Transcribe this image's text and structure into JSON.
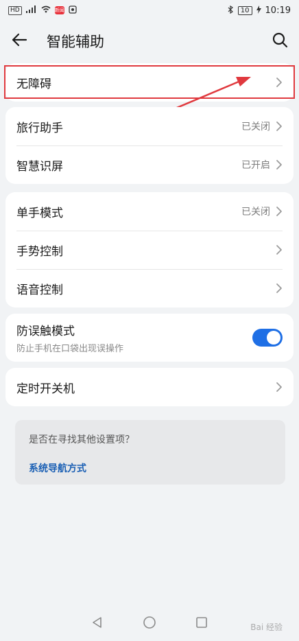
{
  "status_bar": {
    "left_chips": [
      "HD",
      "4G"
    ],
    "red_chip": "新闻",
    "battery": "10",
    "time": "10:19"
  },
  "header": {
    "title": "智能辅助",
    "back_icon": "back-arrow-icon",
    "search_icon": "search-icon"
  },
  "section1": {
    "items": [
      {
        "label": "无障碍",
        "value": ""
      }
    ]
  },
  "section2": {
    "items": [
      {
        "label": "旅行助手",
        "value": "已关闭"
      },
      {
        "label": "智慧识屏",
        "value": "已开启"
      }
    ]
  },
  "section3": {
    "items": [
      {
        "label": "单手模式",
        "value": "已关闭"
      },
      {
        "label": "手势控制",
        "value": ""
      },
      {
        "label": "语音控制",
        "value": ""
      }
    ]
  },
  "section4": {
    "toggle": {
      "title": "防误触模式",
      "subtitle": "防止手机在口袋出现误操作",
      "checked": true
    }
  },
  "section5": {
    "items": [
      {
        "label": "定时开关机",
        "value": ""
      }
    ]
  },
  "suggestion": {
    "question": "是否在寻找其他设置项？",
    "link": "系统导航方式"
  },
  "annotation": {
    "box_color": "#e0393e",
    "arrow_color": "#e0393e"
  },
  "watermark": "Bai 经验"
}
